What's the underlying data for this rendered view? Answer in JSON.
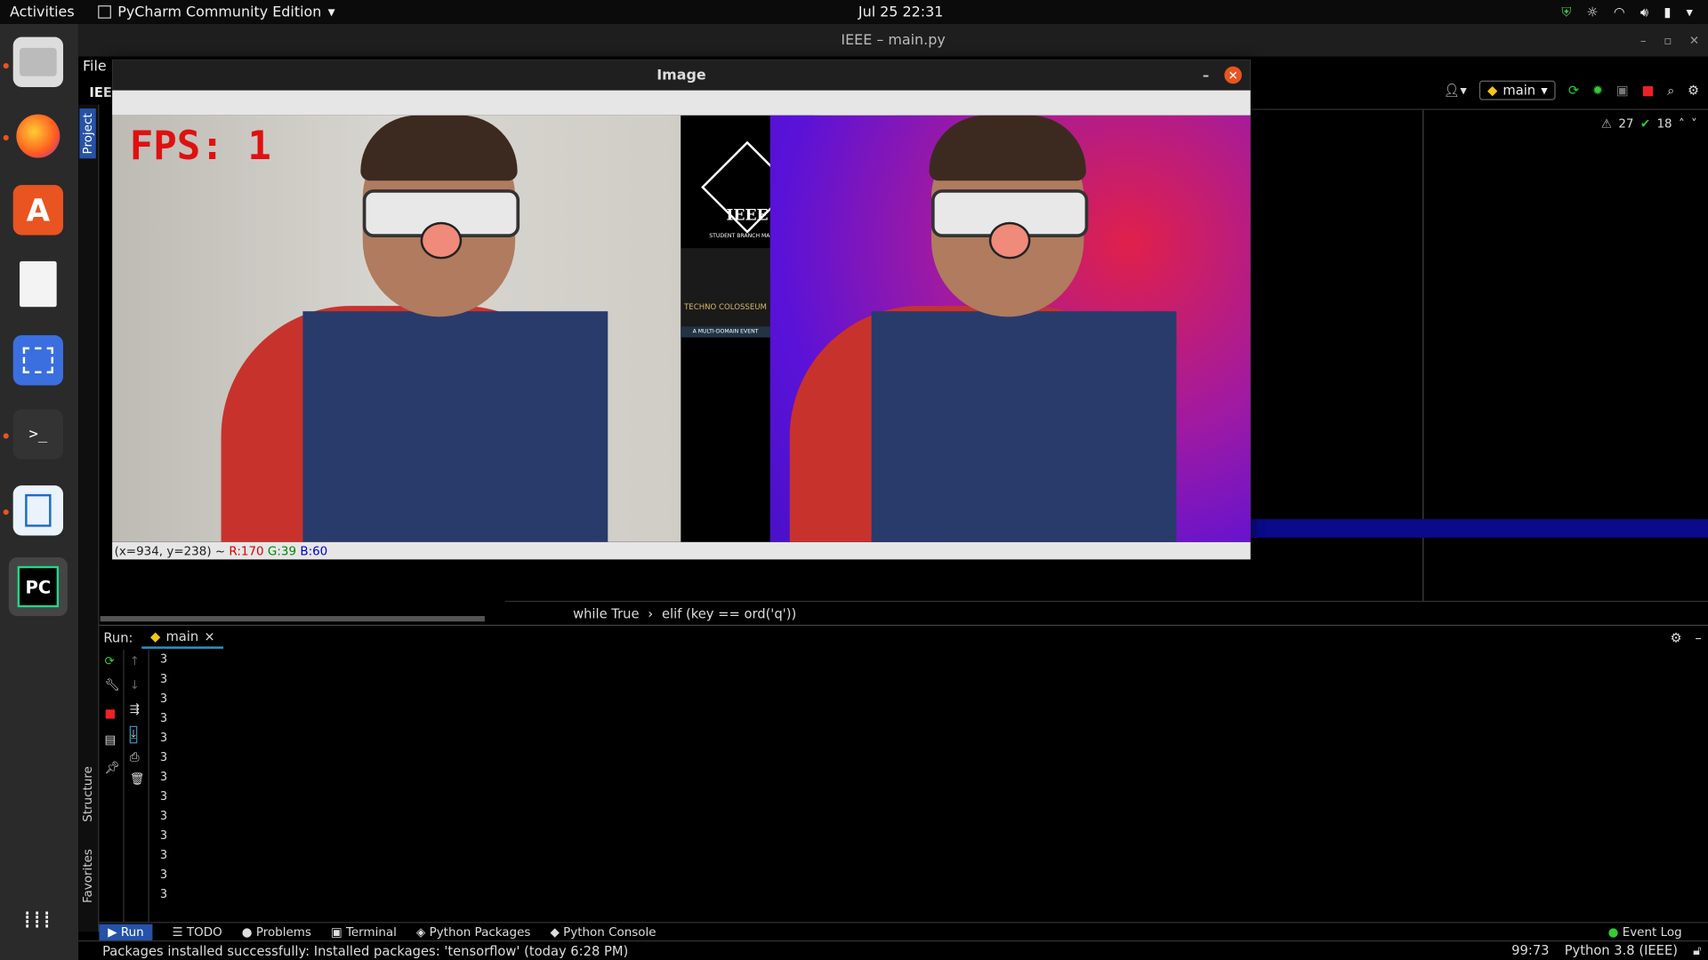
{
  "topbar": {
    "activities": "Activities",
    "app": "PyCharm Community Edition",
    "clock": "Jul 25  22:31"
  },
  "titlebar": {
    "title": "IEEE – main.py"
  },
  "ide": {
    "menu_file": "File",
    "project_label": "IEE",
    "project_tab": "Project",
    "structure_tab": "Structure",
    "favorites_tab": "Favorites",
    "branch": "main",
    "warnings": "27",
    "checks": "18"
  },
  "breadcrumb": {
    "a": "while True",
    "b": "elif (key == ord('q'))"
  },
  "run": {
    "label": "Run:",
    "tab": "main",
    "output": [
      "3",
      "3",
      "3",
      "3",
      "3",
      "3",
      "3",
      "3",
      "3",
      "3",
      "3",
      "3",
      "3"
    ]
  },
  "bottom_tabs": {
    "run": "Run",
    "todo": "TODO",
    "problems": "Problems",
    "terminal": "Terminal",
    "packages": "Python Packages",
    "console": "Python Console",
    "eventlog": "Event Log"
  },
  "status": {
    "message": "Packages installed successfully: Installed packages: 'tensorflow' (today 6:28 PM)",
    "position": "99:73",
    "interpreter": "Python 3.8 (IEEE)"
  },
  "image_window": {
    "title": "Image",
    "fps": "FPS:  1",
    "ieee": "IEEE",
    "ieee_sub": "STUDENT BRANCH MANIPAL",
    "techno": "TECHNO COLOSSEUM",
    "techno_sub": "A MULTI-DOMAIN EVENT",
    "info_pos": "(x=934, y=238) ~",
    "info_r": "R:170",
    "info_g": "G:39",
    "info_b": "B:60"
  },
  "colors": {
    "accent": "#e95420",
    "run_tab": "#2652a8",
    "highlight_row": "#0a0a8a"
  }
}
